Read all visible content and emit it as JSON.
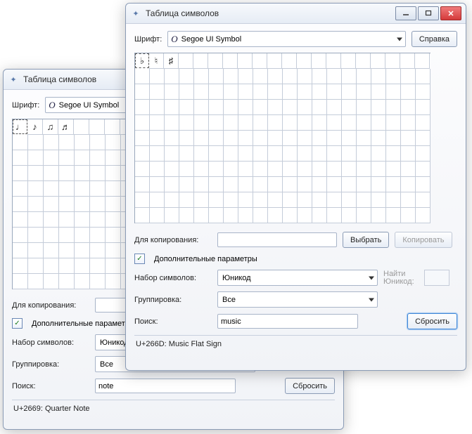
{
  "windows": {
    "back": {
      "title": "Таблица символов",
      "font_label": "Шрифт:",
      "font_value": "Segoe UI Symbol",
      "symbols": [
        "♩",
        "♪",
        "♫",
        "♬"
      ],
      "copy_label": "Для копирования:",
      "adv_label": "Дополнительные параметры",
      "charset_label": "Набор символов:",
      "charset_value": "Юникод",
      "group_label": "Группировка:",
      "group_value": "Все",
      "search_label": "Поиск:",
      "search_value": "note",
      "reset_label": "Сбросить",
      "status": "U+2669: Quarter Note"
    },
    "front": {
      "title": "Таблица символов",
      "font_label": "Шрифт:",
      "font_value": "Segoe UI Symbol",
      "help_label": "Справка",
      "symbols": [
        "♭",
        "♮",
        "♯"
      ],
      "copy_label": "Для копирования:",
      "select_label": "Выбрать",
      "copy_btn_label": "Копировать",
      "adv_label": "Дополнительные параметры",
      "charset_label": "Набор символов:",
      "charset_value": "Юникод",
      "find_label": "Найти Юникод:",
      "group_label": "Группировка:",
      "group_value": "Все",
      "search_label": "Поиск:",
      "search_value": "music",
      "reset_label": "Сбросить",
      "status": "U+266D: Music Flat Sign"
    }
  },
  "grid": {
    "back": {
      "cols": 18,
      "rows": 11
    },
    "front": {
      "cols": 20,
      "rows": 11
    }
  }
}
